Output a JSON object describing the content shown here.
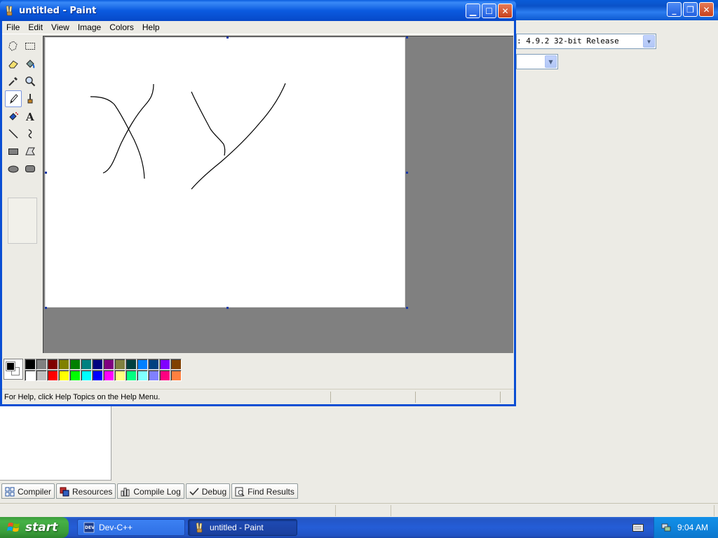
{
  "devcpp": {
    "compiler_select_value": "4.9.2 32-bit Release",
    "bottom_tabs": [
      "Compiler",
      "Resources",
      "Compile Log",
      "Debug",
      "Find Results"
    ]
  },
  "paint": {
    "window_title": "untitled - Paint",
    "menu": [
      "File",
      "Edit",
      "View",
      "Image",
      "Colors",
      "Help"
    ],
    "status_text": "For Help, click Help Topics on the Help Menu.",
    "foreground_color": "#000000",
    "background_color": "#ffffff",
    "palette_row1": [
      "#000000",
      "#808080",
      "#800000",
      "#808000",
      "#008000",
      "#008080",
      "#000080",
      "#800080",
      "#808040",
      "#004040",
      "#0080ff",
      "#004080",
      "#8000ff",
      "#804000"
    ],
    "palette_row2": [
      "#ffffff",
      "#c0c0c0",
      "#ff0000",
      "#ffff00",
      "#00ff00",
      "#00ffff",
      "#0000ff",
      "#ff00ff",
      "#ffff80",
      "#00ff80",
      "#80ffff",
      "#8080ff",
      "#ff0080",
      "#ff8040"
    ],
    "tools": [
      "free-form-select",
      "select",
      "eraser",
      "fill-with-color",
      "pick-color",
      "magnifier",
      "pencil",
      "brush",
      "airbrush",
      "text",
      "line",
      "curve",
      "rectangle",
      "polygon",
      "ellipse",
      "rounded-rectangle"
    ],
    "selected_tool": "pencil"
  },
  "taskbar": {
    "start_label": "start",
    "tasks": [
      "Dev-C++",
      "untitled - Paint"
    ],
    "clock": "9:04 AM"
  }
}
